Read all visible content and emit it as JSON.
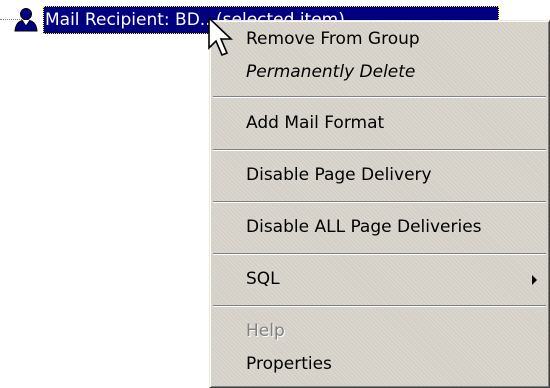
{
  "tree": {
    "selected_item_label": "Mail Recipient: BD...(selected item)"
  },
  "context_menu": {
    "items": [
      {
        "label": "Remove From Group"
      },
      {
        "label": "Permanently Delete"
      },
      {
        "label": "Add Mail Format"
      },
      {
        "label": "Disable Page Delivery"
      },
      {
        "label": "Disable ALL Page Deliveries"
      },
      {
        "label": "SQL"
      },
      {
        "label": "Help"
      },
      {
        "label": "Properties"
      }
    ]
  },
  "colors": {
    "selection_background": "#000080",
    "menu_background": "#d4d0c8",
    "disabled_text": "#808080"
  },
  "icons": {
    "recipient": "user-icon",
    "submenu": "triangle-right-icon",
    "cursor": "arrow-pointer-icon"
  }
}
